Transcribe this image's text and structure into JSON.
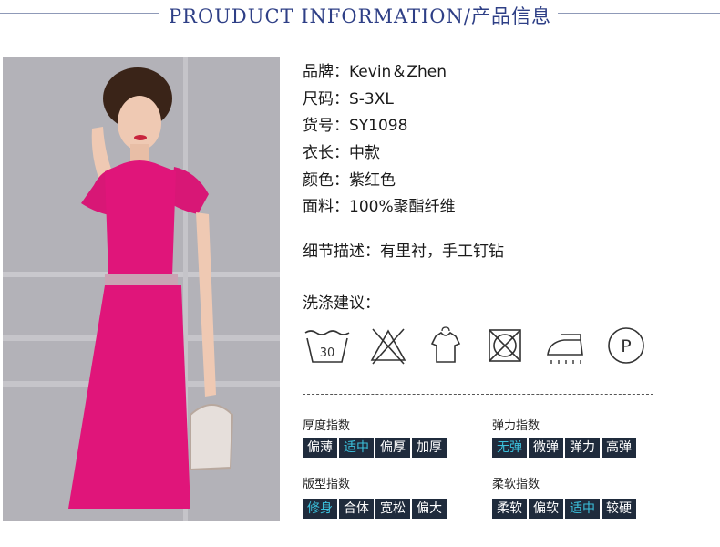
{
  "header": {
    "title": "PROUDUCT INFORMATION/产品信息"
  },
  "specs": [
    {
      "key": "品牌：",
      "value": "Kevin＆Zhen"
    },
    {
      "key": "尺码：",
      "value": "S-3XL"
    },
    {
      "key": "货号：",
      "value": "SY1098"
    },
    {
      "key": "衣长：",
      "value": "中款"
    },
    {
      "key": "颜色：",
      "value": "紫红色"
    },
    {
      "key": "面料：",
      "value": "100%聚酯纤维"
    }
  ],
  "detail": "细节描述：有里衬，手工钉钻",
  "wash": {
    "title": "洗涤建议：",
    "tub_temp": "30",
    "icons": [
      "wash-30-icon",
      "no-bleach-icon",
      "hang-dry-icon",
      "no-tumble-dry-icon",
      "iron-icon",
      "dry-clean-p-icon"
    ],
    "dry_clean_letter": "P"
  },
  "indices": [
    {
      "title": "厚度指数",
      "options": [
        "偏薄",
        "适中",
        "偏厚",
        "加厚"
      ],
      "selected": "适中"
    },
    {
      "title": "弹力指数",
      "options": [
        "无弹",
        "微弹",
        "弹力",
        "高弹"
      ],
      "selected": "无弹"
    },
    {
      "title": "版型指数",
      "options": [
        "修身",
        "合体",
        "宽松",
        "偏大"
      ],
      "selected": "修身"
    },
    {
      "title": "柔软指数",
      "options": [
        "柔软",
        "偏软",
        "适中",
        "较硬"
      ],
      "selected": "适中"
    }
  ],
  "colors": {
    "header": "#2e3f86",
    "dress": "#e0157a",
    "chip_bg": "#1f2b3c",
    "chip_selected_text": "#3bc0dc"
  }
}
